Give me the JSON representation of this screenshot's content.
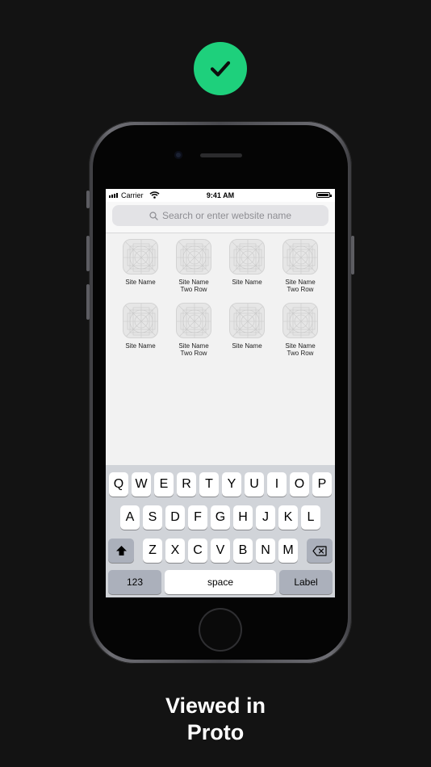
{
  "colors": {
    "accent": "#1ed07c",
    "background": "#131313"
  },
  "badge": {
    "icon": "checkmark-icon"
  },
  "status_bar": {
    "carrier": "Carrier",
    "time": "9:41 AM"
  },
  "search": {
    "placeholder": "Search or enter website name"
  },
  "sites": [
    {
      "label": "Site Name"
    },
    {
      "label": "Site Name\nTwo Row"
    },
    {
      "label": "Site Name"
    },
    {
      "label": "Site Name\nTwo Row"
    },
    {
      "label": "Site Name"
    },
    {
      "label": "Site Name\nTwo Row"
    },
    {
      "label": "Site Name"
    },
    {
      "label": "Site Name\nTwo Row"
    }
  ],
  "keyboard": {
    "row1": [
      "Q",
      "W",
      "E",
      "R",
      "T",
      "Y",
      "U",
      "I",
      "O",
      "P"
    ],
    "row2": [
      "A",
      "S",
      "D",
      "F",
      "G",
      "H",
      "J",
      "K",
      "L"
    ],
    "row3": [
      "Z",
      "X",
      "C",
      "V",
      "B",
      "N",
      "M"
    ],
    "numbers_label": "123",
    "space_label": "space",
    "return_label": "Label"
  },
  "caption": {
    "line1": "Viewed in",
    "line2": "Proto"
  }
}
